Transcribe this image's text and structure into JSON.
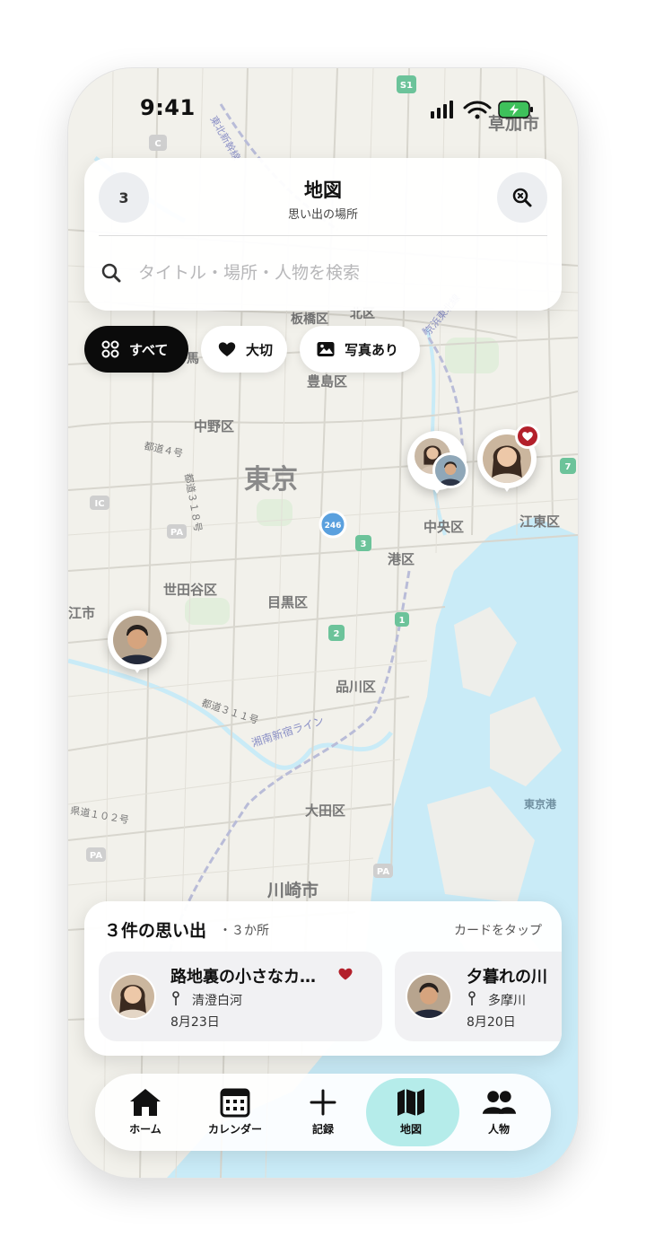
{
  "status_bar": {
    "time": "9:41"
  },
  "header": {
    "count": "3",
    "title": "地図",
    "subtitle": "思い出の場所",
    "search_placeholder": "タイトル・場所・人物を検索"
  },
  "filters": [
    {
      "label": "すべて",
      "active": true,
      "icon": "grid-icon"
    },
    {
      "label": "大切",
      "active": false,
      "icon": "heart-icon"
    },
    {
      "label": "写真あり",
      "active": false,
      "icon": "photo-icon"
    }
  ],
  "map": {
    "labels": {
      "soka": "草加市",
      "tokyo": "東京",
      "itabashi": "板橋区",
      "kita": "北区",
      "toshima": "豊島区",
      "nakano": "中野区",
      "chuo": "中央区",
      "koto": "江東区",
      "minato": "港区",
      "setagaya": "世田谷区",
      "meguro": "目黒区",
      "shinagawa": "品川区",
      "ota": "大田区",
      "kawasaki": "川崎市",
      "tokyo_port": "東京港",
      "route4": "都道４号",
      "route318": "都道３１８号",
      "route311": "都道３１１号",
      "route102": "県道１０２号",
      "shonan": "湘南新宿ライン",
      "tohoku": "東北新幹線",
      "keihin": "京浜東北線",
      "city_edge_left": "江市",
      "city_edge_ward": "馬",
      "route_246": "246",
      "route_s1": "S1",
      "route_c": "C",
      "route_3": "3",
      "route_2": "2",
      "route_1": "1",
      "route_7": "7",
      "ic": "IC",
      "pa": "PA"
    }
  },
  "memories": {
    "title": "３件の思い出",
    "places": "・３か所",
    "hint": "カードをタップ",
    "items": [
      {
        "title": "路地裏の小さなカ…",
        "place": "清澄白河",
        "date": "8月23日",
        "favorite": true,
        "avatar": "woman"
      },
      {
        "title": "夕暮れの川",
        "place": "多摩川",
        "date": "8月20日",
        "favorite": false,
        "avatar": "man"
      }
    ]
  },
  "tabs": [
    {
      "label": "ホーム",
      "icon": "home-icon",
      "active": false
    },
    {
      "label": "カレンダー",
      "icon": "calendar-icon",
      "active": false
    },
    {
      "label": "記録",
      "icon": "plus-icon",
      "active": false
    },
    {
      "label": "地図",
      "icon": "map-icon",
      "active": true
    },
    {
      "label": "人物",
      "icon": "people-icon",
      "active": false
    }
  ],
  "colors": {
    "accent": "#b5ecea",
    "favorite": "#b3202b",
    "water": "#c9ebf7",
    "land": "#f1f0ea"
  }
}
